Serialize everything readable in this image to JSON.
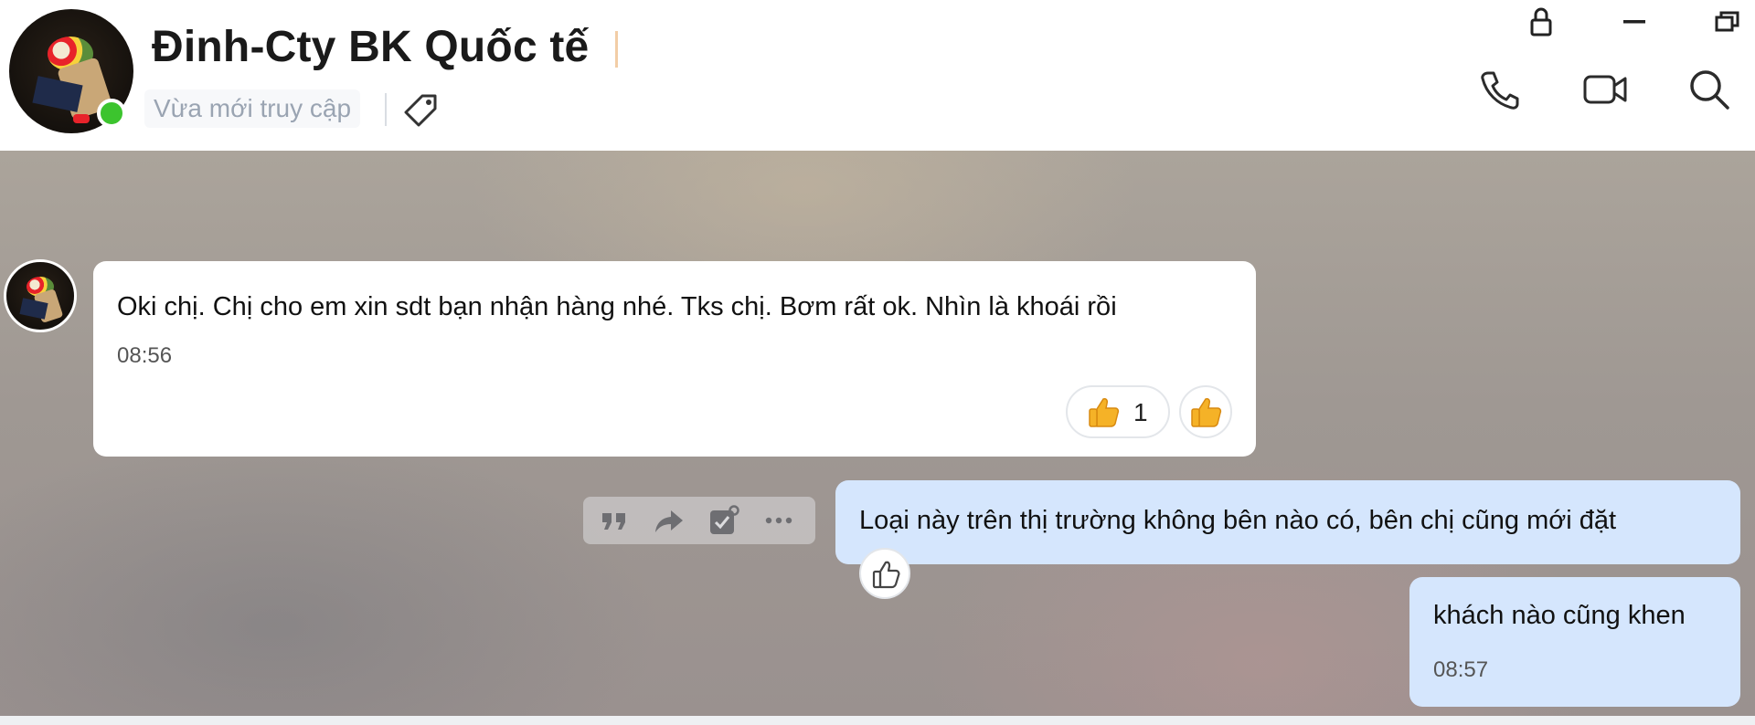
{
  "header": {
    "contact_name": "Đinh-Cty BK Quốc tế",
    "status_text": "Vừa mới truy cập",
    "window_buttons": [
      "lock-icon",
      "minimize-icon",
      "restore-icon"
    ],
    "actions": [
      "phone-icon",
      "video-icon",
      "search-icon"
    ],
    "online_color": "#3cc42e"
  },
  "messages": [
    {
      "direction": "incoming",
      "text": "Oki chị. Chị cho em xin sdt bạn nhận hàng nhé. Tks chị. Bơm rất ok. Nhìn là khoái rồi",
      "time": "08:56",
      "reaction_emoji": "thumbs-up",
      "reaction_count": "1"
    },
    {
      "direction": "outgoing",
      "text": "Loại này trên thị trường không bên nào có, bên chị cũng mới đặt"
    },
    {
      "direction": "outgoing",
      "text": "khách nào cũng khen",
      "time": "08:57"
    }
  ],
  "message_actions": [
    "quote-icon",
    "forward-icon",
    "todo-icon",
    "more-icon"
  ],
  "colors": {
    "outgoing_bubble": "#d5e6fd",
    "incoming_bubble": "#ffffff"
  }
}
